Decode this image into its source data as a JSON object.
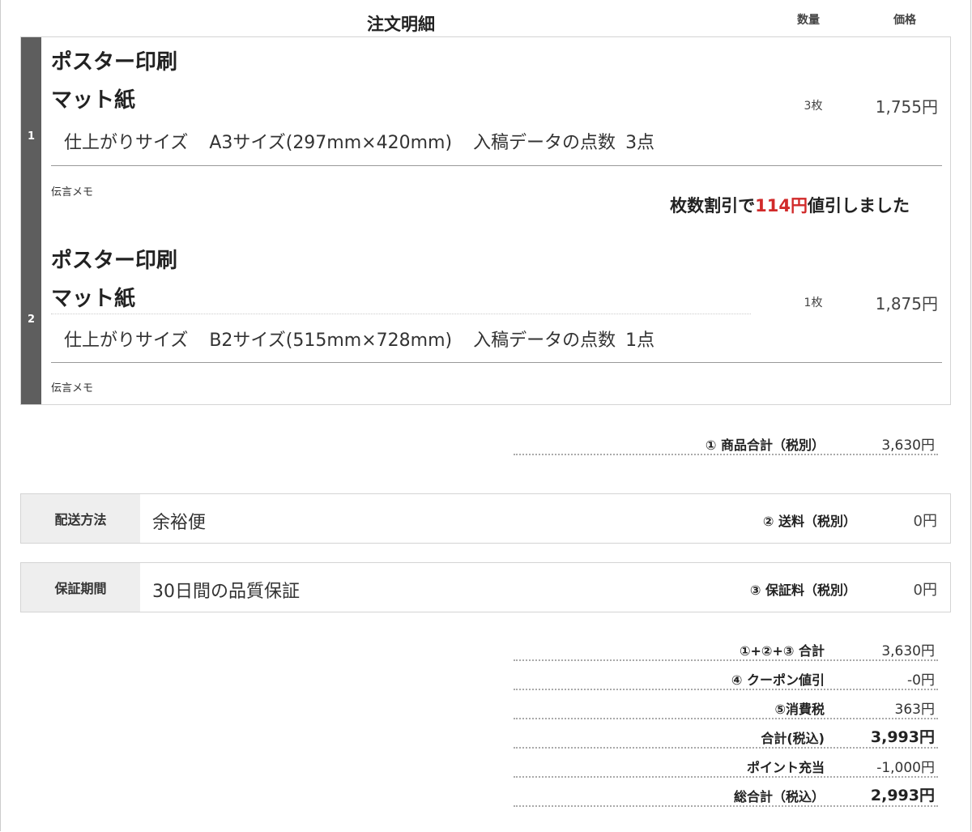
{
  "header": {
    "title": "注文明細",
    "qty_label": "数量",
    "price_label": "価格"
  },
  "items": [
    {
      "index": "1",
      "name1": "ポスター印刷",
      "name2": "マット紙",
      "size_label": "仕上がりサイズ",
      "size_value": "A3サイズ(297mm×420mm)",
      "data_label": "入稿データの点数",
      "data_value": "3点",
      "qty": "3枚",
      "price": "1,755円",
      "memo_label": "伝言メモ"
    },
    {
      "index": "2",
      "name1": "ポスター印刷",
      "name2": "マット紙",
      "size_label": "仕上がりサイズ",
      "size_value": "B2サイズ(515mm×728mm)",
      "data_label": "入稿データの点数",
      "data_value": "1点",
      "qty": "1枚",
      "price": "1,875円",
      "memo_label": "伝言メモ"
    }
  ],
  "discount": {
    "prefix": "枚数割引で",
    "amount": "114円",
    "suffix": "値引しました"
  },
  "subtotal": {
    "label": "① 商品合計（税別）",
    "value": "3,630円"
  },
  "shipping": {
    "key": "配送方法",
    "value": "余裕便",
    "fee_label": "② 送料（税別）",
    "fee": "0円"
  },
  "warranty": {
    "key": "保証期間",
    "value": "30日間の品質保証",
    "fee_label": "③ 保証料（税別）",
    "fee": "0円"
  },
  "totals": [
    {
      "label": "①+②+③ 合計",
      "value": "3,630円"
    },
    {
      "label": "④ クーポン値引",
      "value": "-0円"
    },
    {
      "label": "⑤消費税",
      "value": "363円"
    },
    {
      "label": "合計(税込)",
      "value": "3,993円"
    },
    {
      "label": "ポイント充当",
      "value": "-1,000円"
    },
    {
      "label": "総合計（税込）",
      "value": "2,993円"
    }
  ]
}
